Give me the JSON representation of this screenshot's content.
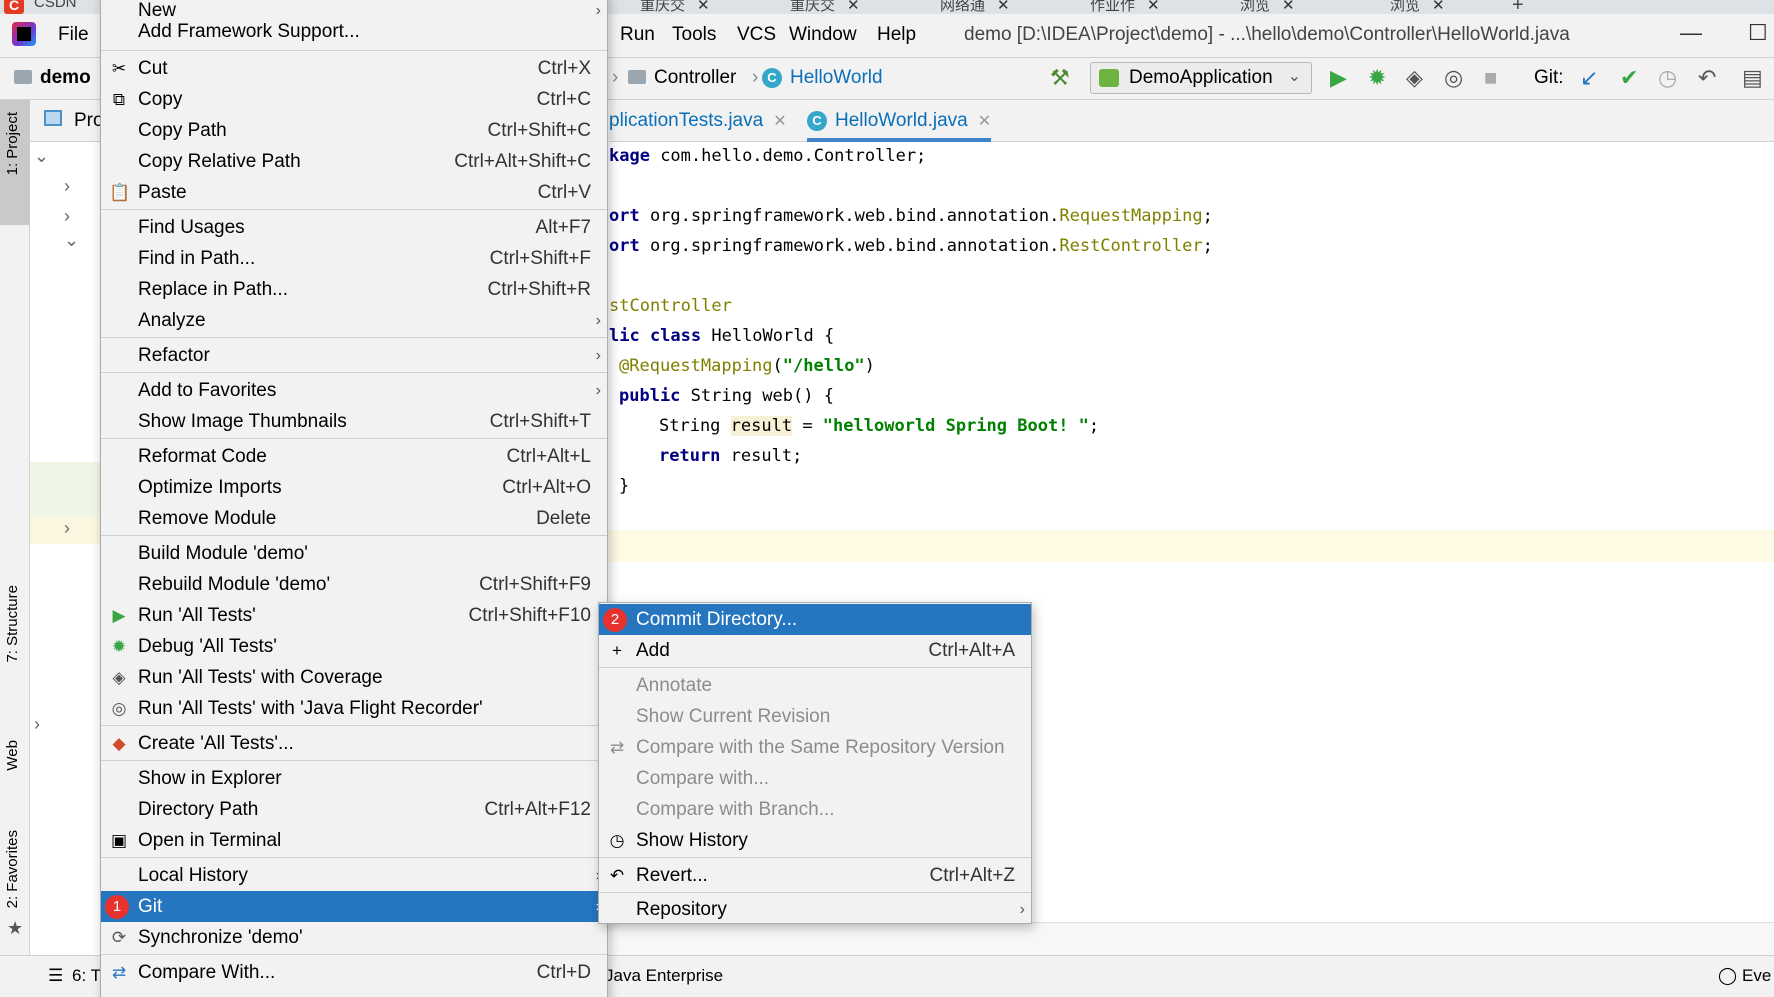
{
  "browser_tabs": [
    {
      "label": "CSDN"
    },
    {
      "label": "重庆交"
    },
    {
      "label": "重庆交"
    },
    {
      "label": "网络通"
    },
    {
      "label": "作业作"
    },
    {
      "label": "浏览"
    },
    {
      "label": "浏览"
    }
  ],
  "browser_new_tab": "+",
  "menubar": {
    "items": [
      "File",
      "Run",
      "Tools",
      "VCS",
      "Window",
      "Help"
    ],
    "title": "demo [D:\\IDEA\\Project\\demo] - ...\\hello\\demo\\Controller\\HelloWorld.java",
    "minimize": "—",
    "maximize": "☐"
  },
  "navbar": {
    "project": "demo",
    "crumb_folder": "Controller",
    "crumb_class": "HelloWorld",
    "run_config": "DemoApplication",
    "git_label": "Git:"
  },
  "left_stripe": {
    "project": "1: Project",
    "structure": "7: Structure",
    "web": "Web",
    "favorites": "2: Favorites"
  },
  "project_panel": {
    "header": "Pro"
  },
  "editor_tabs": [
    {
      "label": "plicationTests.java"
    },
    {
      "label": "HelloWorld.java"
    }
  ],
  "code": {
    "l1_a": "kage ",
    "l1_b": "com.hello.demo.Controller;",
    "l2_a": "ort ",
    "l2_b": "org.springframework.web.bind.annotation.",
    "l2_c": "RequestMapping",
    "l2_d": ";",
    "l3_a": "ort ",
    "l3_b": "org.springframework.web.bind.annotation.",
    "l3_c": "RestController",
    "l3_d": ";",
    "l4": "stController",
    "l5_a": "lic class ",
    "l5_b": "HelloWorld {",
    "l6_a": "@RequestMapping",
    "l6_b": "(",
    "l6_c": "\"/hello\"",
    "l6_d": ")",
    "l7_a": "public ",
    "l7_b": "String web() {",
    "l8_a": "String ",
    "l8_b": "result",
    "l8_c": " = ",
    "l8_d": "\"helloworld Spring Boot! \"",
    "l8_e": ";",
    "l9_a": "return ",
    "l9_b": "result;",
    "l10": "}"
  },
  "context_menu": {
    "new": "New",
    "add_framework": "Add Framework Support...",
    "cut": "Cut",
    "cut_sc": "Ctrl+X",
    "copy": "Copy",
    "copy_sc": "Ctrl+C",
    "copy_path": "Copy Path",
    "copy_path_sc": "Ctrl+Shift+C",
    "copy_rel": "Copy Relative Path",
    "copy_rel_sc": "Ctrl+Alt+Shift+C",
    "paste": "Paste",
    "paste_sc": "Ctrl+V",
    "find_usages": "Find Usages",
    "find_usages_sc": "Alt+F7",
    "find_in_path": "Find in Path...",
    "find_in_path_sc": "Ctrl+Shift+F",
    "replace_in_path": "Replace in Path...",
    "replace_in_path_sc": "Ctrl+Shift+R",
    "analyze": "Analyze",
    "refactor": "Refactor",
    "add_fav": "Add to Favorites",
    "thumbs": "Show Image Thumbnails",
    "thumbs_sc": "Ctrl+Shift+T",
    "reformat": "Reformat Code",
    "reformat_sc": "Ctrl+Alt+L",
    "optimize": "Optimize Imports",
    "optimize_sc": "Ctrl+Alt+O",
    "remove_module": "Remove Module",
    "remove_module_sc": "Delete",
    "build_module": "Build Module 'demo'",
    "rebuild_module": "Rebuild Module 'demo'",
    "rebuild_module_sc": "Ctrl+Shift+F9",
    "run_tests": "Run 'All Tests'",
    "run_tests_sc": "Ctrl+Shift+F10",
    "debug_tests": "Debug 'All Tests'",
    "run_coverage": "Run 'All Tests' with Coverage",
    "run_jfr": "Run 'All Tests' with 'Java Flight Recorder'",
    "create_tests": "Create 'All Tests'...",
    "show_explorer": "Show in Explorer",
    "dir_path": "Directory Path",
    "dir_path_sc": "Ctrl+Alt+F12",
    "open_terminal": "Open in Terminal",
    "local_history": "Local History",
    "git": "Git",
    "sync": "Synchronize 'demo'",
    "compare_with": "Compare With...",
    "compare_with_sc": "Ctrl+D",
    "badge_1": "1"
  },
  "git_menu": {
    "commit_dir": "Commit Directory...",
    "badge_2": "2",
    "add": "Add",
    "add_sc": "Ctrl+Alt+A",
    "annotate": "Annotate",
    "show_current": "Show Current Revision",
    "compare_same": "Compare with the Same Repository Version",
    "compare_with": "Compare with...",
    "compare_branch": "Compare with Branch...",
    "show_history": "Show History",
    "revert": "Revert...",
    "revert_sc": "Ctrl+Alt+Z",
    "repository": "Repository"
  },
  "bottom": {
    "todo": "6: T",
    "java_enterprise": "Java Enterprise",
    "event": "Eve"
  },
  "colors": {
    "selection": "#2675bf",
    "badge": "#e8322e",
    "keyword": "#000080",
    "annotation": "#808000",
    "string": "#008000"
  }
}
